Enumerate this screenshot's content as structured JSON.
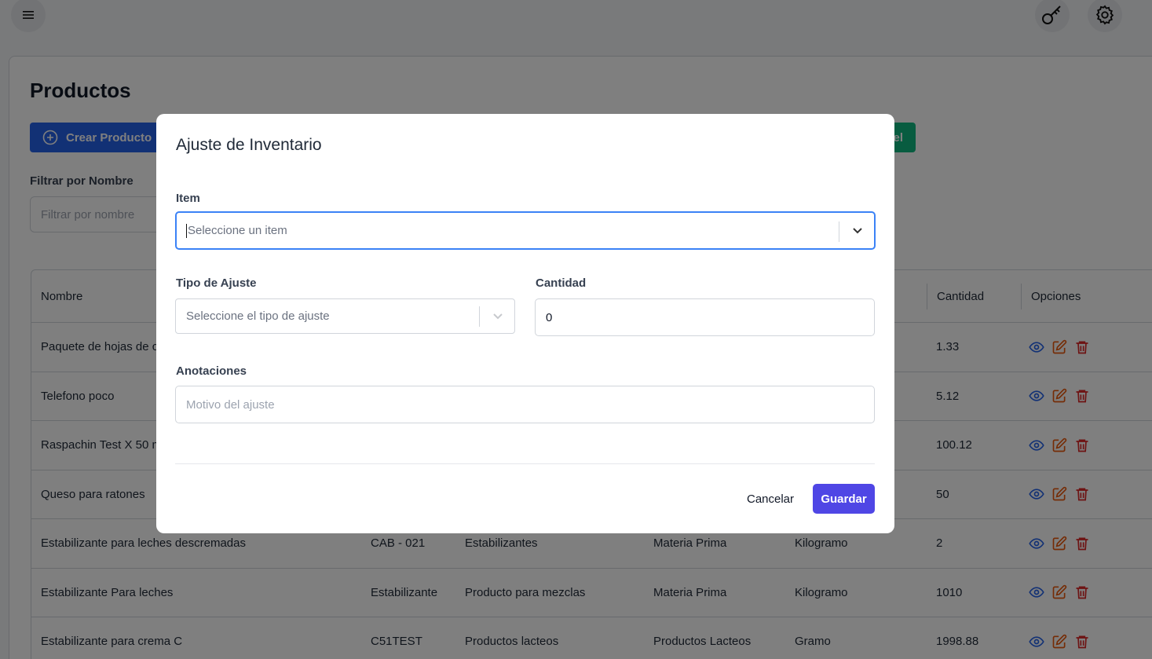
{
  "topbar": {
    "menu_icon": "menu-icon",
    "key_icon": "key-icon",
    "settings_icon": "gear-icon"
  },
  "page": {
    "title": "Productos",
    "create_button": "Crear Producto",
    "excel_button": "el",
    "filter_label": "Filtrar por Nombre",
    "filter_placeholder": "Filtrar por nombre"
  },
  "table": {
    "headers": {
      "name": "Nombre",
      "qty": "Cantidad",
      "options": "Opciones"
    },
    "rows": [
      {
        "name": "Paquete de hojas de c",
        "code": "",
        "category": "",
        "type": "",
        "unit": "",
        "qty": "1.33"
      },
      {
        "name": "Telefono poco",
        "code": "",
        "category": "",
        "type": "",
        "unit": "",
        "qty": "5.12"
      },
      {
        "name": "Raspachin Test X 50 m",
        "code": "",
        "category": "",
        "type": "",
        "unit": "",
        "qty": "100.12"
      },
      {
        "name": "Queso para ratones",
        "code": "",
        "category": "",
        "type": "",
        "unit": "",
        "qty": "50"
      },
      {
        "name": "Estabilizante para leches descremadas",
        "code": "CAB - 021",
        "category": "Estabilizantes",
        "type": "Materia Prima",
        "unit": "Kilogramo",
        "qty": "2"
      },
      {
        "name": "Estabilizante Para leches",
        "code": "Estabilizante",
        "category": "Producto para mezclas",
        "type": "Materia Prima",
        "unit": "Kilogramo",
        "qty": "1010"
      },
      {
        "name": "Estabilizante para crema C",
        "code": "C51TEST",
        "category": "Productos lacteos",
        "type": "Productos Lacteos",
        "unit": "Gramo",
        "qty": "1998.88"
      }
    ]
  },
  "colors": {
    "view": "#2563eb",
    "edit": "#ea580c",
    "delete": "#dc2626",
    "primary": "#4f46e5"
  },
  "modal": {
    "title": "Ajuste de Inventario",
    "item_label": "Item",
    "item_placeholder": "Seleccione un item",
    "type_label": "Tipo de Ajuste",
    "type_placeholder": "Seleccione el tipo de ajuste",
    "qty_label": "Cantidad",
    "qty_value": "0",
    "notes_label": "Anotaciones",
    "notes_placeholder": "Motivo del ajuste",
    "cancel": "Cancelar",
    "save": "Guardar"
  }
}
